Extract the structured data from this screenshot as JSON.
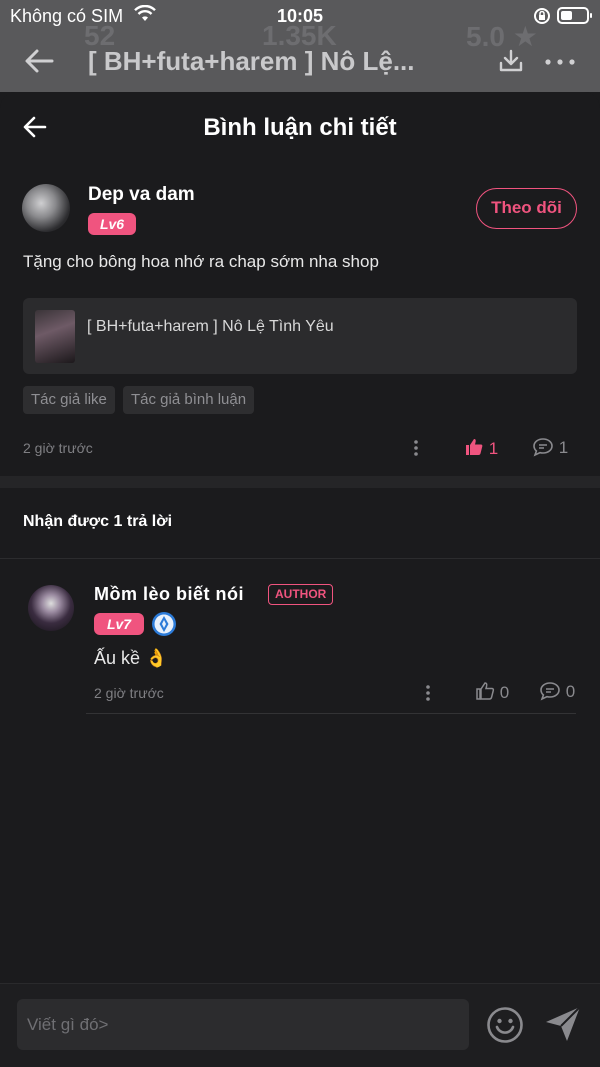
{
  "status_bar": {
    "carrier": "Không có SIM",
    "time": "10:05"
  },
  "background_header": {
    "title": "[ BH+futa+harem ] Nô Lệ...",
    "ghost_stats": [
      "52",
      "1.35K",
      "5.0 ★"
    ]
  },
  "sheet": {
    "title": "Bình luận chi tiết"
  },
  "comment": {
    "username": "Dep va dam",
    "level": "Lv6",
    "follow_label": "Theo dõi",
    "text": "Tặng cho bông hoa nhớ ra chap sớm nha shop",
    "book_title": "[ BH+futa+harem ] Nô Lệ Tình Yêu",
    "tags": [
      "Tác giả like",
      "Tác giả bình luận"
    ],
    "time": "2 giờ trước",
    "likes": "1",
    "replies": "1",
    "like_color": "#f0547f"
  },
  "replies_header": "Nhận được 1 trả lời",
  "reply": {
    "username": "Mồm lèo biết nói",
    "author_badge": "AUTHOR",
    "level": "Lv7",
    "text": "Ấu kề 👌",
    "time": "2 giờ trước",
    "likes": "0",
    "replies": "0"
  },
  "input": {
    "placeholder": "Viết gì đó>"
  },
  "colors": {
    "accent": "#f0547f",
    "background": "#1b1b1d"
  }
}
